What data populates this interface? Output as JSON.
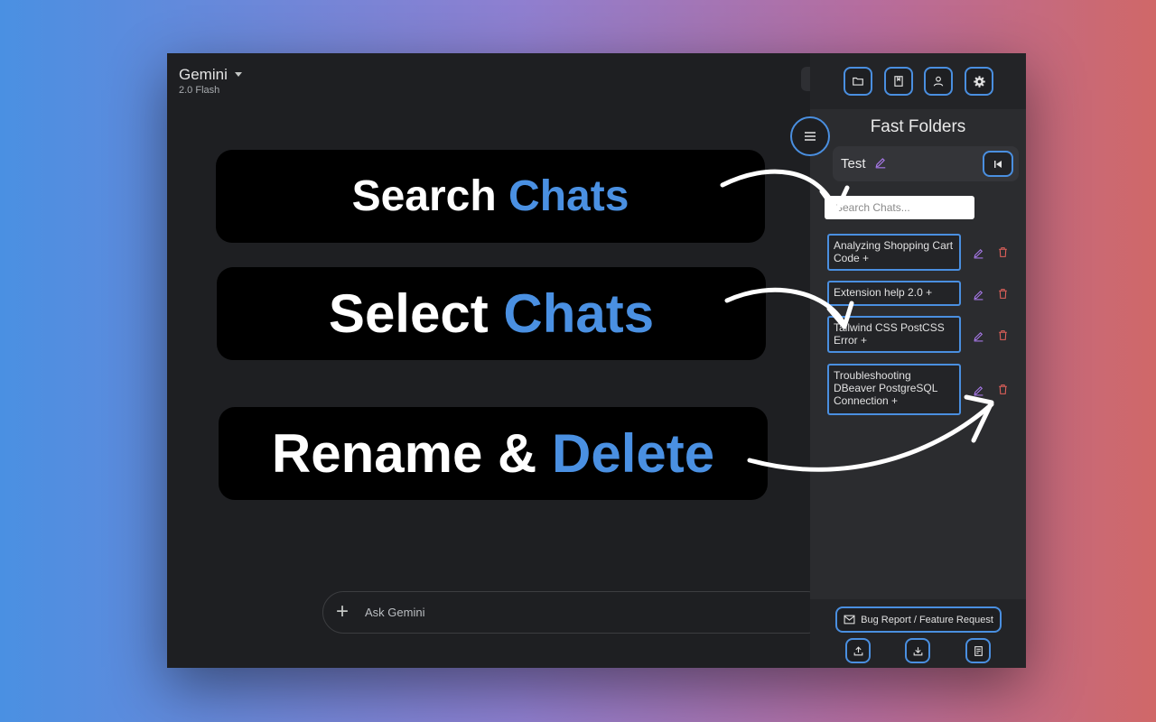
{
  "app": {
    "title": "Gemini",
    "subtitle": "2.0 Flash"
  },
  "promos": {
    "search": {
      "word": "Search",
      "accent": "Chats"
    },
    "select": {
      "word": "Select",
      "accent": "Chats"
    },
    "rename": {
      "word": "Rename &",
      "accent": "Delete"
    }
  },
  "composer": {
    "placeholder": "Ask Gemini",
    "add_icon": "plus-icon"
  },
  "panel": {
    "title": "Fast Folders",
    "toolbar_icons": [
      "folder-icon",
      "bookmark-icon",
      "user-icon",
      "settings-icon"
    ],
    "folder": {
      "name": "Test"
    },
    "search": {
      "placeholder": "Search Chats..."
    },
    "chats": [
      {
        "label": "Analyzing Shopping Cart Code +"
      },
      {
        "label": "Extension help 2.0 +"
      },
      {
        "label": "Tailwind CSS PostCSS Error +"
      },
      {
        "label": "Troubleshooting DBeaver PostgreSQL Connection +"
      }
    ],
    "footer": {
      "bug_report_label": "Bug Report / Feature Request"
    }
  },
  "colors": {
    "accent": "#4a90e2",
    "edit": "#a778e8",
    "delete": "#e0605a",
    "panel_bg": "#2b2c2f",
    "window_bg": "#1e1f22"
  }
}
